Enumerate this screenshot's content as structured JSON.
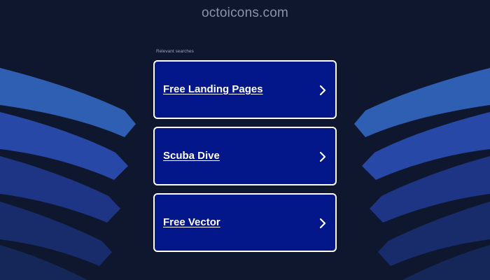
{
  "header": {
    "domain": "octoicons.com"
  },
  "results": {
    "heading": "Relevant searches",
    "items": [
      {
        "label": "Free Landing Pages",
        "icon": "chevron-right-icon"
      },
      {
        "label": "Scuba Dive",
        "icon": "chevron-right-icon"
      },
      {
        "label": "Free Vector",
        "icon": "chevron-right-icon"
      }
    ]
  },
  "colors": {
    "background": "#0f172e",
    "card": "#03168a",
    "card_border": "#ffffff",
    "wave_light": "#2f5fb3",
    "wave_mid": "#2848a8",
    "wave_dark": "#1d3584",
    "wave_darkest": "#182c6c"
  }
}
